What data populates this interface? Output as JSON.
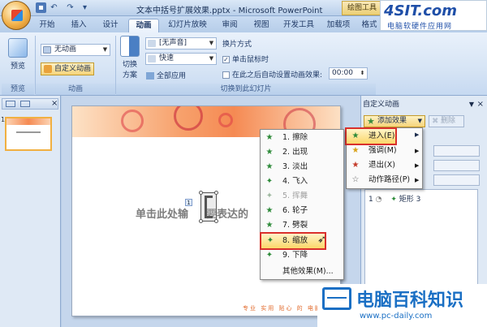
{
  "window": {
    "title": "文本中括号扩展效果.pptx - Microsoft PowerPoint",
    "context_tab": "绘图工具",
    "qat_icons": [
      "save-icon",
      "undo-icon",
      "redo-icon",
      "customize-icon"
    ]
  },
  "tabs": [
    "开始",
    "插入",
    "设计",
    "动画",
    "幻灯片放映",
    "审阅",
    "视图",
    "开发工具",
    "加载项",
    "格式"
  ],
  "active_tab": "动画",
  "ribbon": {
    "preview": {
      "label": "预览",
      "group": "预览"
    },
    "animation": {
      "animate_select": "无动画",
      "custom_label": "自定义动画",
      "group": "动画"
    },
    "transition": {
      "scheme_label_1": "切换",
      "scheme_label_2": "方案",
      "sound_select": "[无声音]",
      "speed_select": "快速",
      "apply_all": "全部应用",
      "advance_title": "换片方式",
      "on_click": "单击鼠标时",
      "after_time": "在此之后自动设置动画效果:",
      "time_value": "00:00",
      "group": "切换到此幻灯片"
    }
  },
  "slides_pane": {
    "thumb_number": "1"
  },
  "slide": {
    "text_left": "单击此处输",
    "text_right": "要表达的",
    "anim_tag": "1",
    "footer_text": "专业 实用 贴心 的 电脑学习"
  },
  "task_pane": {
    "title": "自定义动画",
    "add_effect": "添加效果",
    "remove": "删除",
    "list_item": {
      "index": "1",
      "label": "矩形 3"
    }
  },
  "effect_menu": [
    {
      "label": "进入(E)",
      "icon": "enter-star-icon",
      "highlighted": true
    },
    {
      "label": "强调(M)",
      "icon": "emphasis-star-icon"
    },
    {
      "label": "退出(X)",
      "icon": "exit-star-icon"
    },
    {
      "label": "动作路径(P)",
      "icon": "motion-path-star-icon"
    }
  ],
  "entrance_menu": [
    {
      "label": "1. 擦除",
      "enabled": true
    },
    {
      "label": "2. 出现",
      "enabled": true
    },
    {
      "label": "3. 淡出",
      "enabled": true
    },
    {
      "label": "4. 飞入",
      "enabled": true
    },
    {
      "label": "5. 挥舞",
      "enabled": false
    },
    {
      "label": "6. 轮子",
      "enabled": true
    },
    {
      "label": "7. 劈裂",
      "enabled": true
    },
    {
      "label": "8. 缩放",
      "enabled": true,
      "highlighted": true
    },
    {
      "label": "9. 下降",
      "enabled": true
    },
    {
      "label": "其他效果(M)...",
      "enabled": true
    }
  ],
  "watermark_top": {
    "brand": "4SIT.com",
    "sub": "电脑软硬件应用网"
  },
  "watermark_bottom": {
    "brand": "电脑百科知识",
    "url": "www.pc-daily.com"
  },
  "colors": {
    "accent": "#f6d47a",
    "highlight_border": "#d9302c",
    "star_green": "#2e8b3a"
  }
}
